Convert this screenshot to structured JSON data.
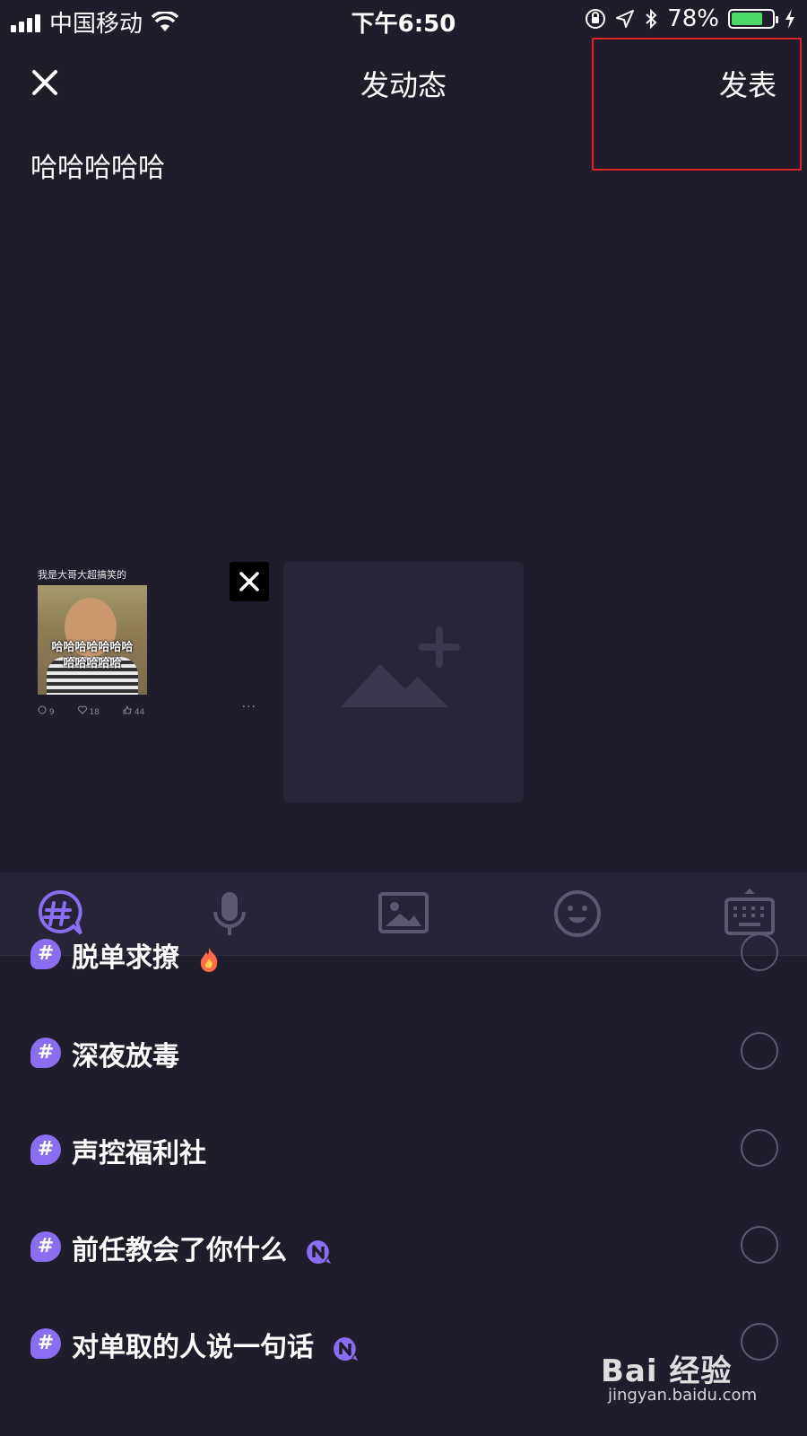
{
  "status_bar": {
    "carrier": "中国移动",
    "time": "下午6:50",
    "battery": "78%",
    "battery_level": 0.78,
    "icons": [
      "signal-icon",
      "wifi-icon",
      "orientation-lock-icon",
      "location-icon",
      "bluetooth-icon",
      "battery-icon",
      "charging-icon"
    ]
  },
  "nav": {
    "title": "发动态",
    "publish_label": "发表",
    "close_icon": "close-icon"
  },
  "post": {
    "text": "哈哈哈哈哈"
  },
  "attachment": {
    "caption": "我是大哥大超搞笑的",
    "image_text_line1": "哈哈哈哈哈哈哈",
    "image_text_line2": "哈哈哈哈哈",
    "stats": {
      "comments": "9",
      "favorites": "18",
      "likes": "44"
    },
    "more": "···"
  },
  "toolbar": {
    "tools": [
      "topic-icon",
      "microphone-icon",
      "image-icon",
      "emoji-icon",
      "keyboard-icon"
    ]
  },
  "topics": [
    {
      "label": "脱单求撩",
      "badge": "hot"
    },
    {
      "label": "深夜放毒",
      "badge": ""
    },
    {
      "label": "声控福利社",
      "badge": ""
    },
    {
      "label": "前任教会了你什么",
      "badge": "new"
    },
    {
      "label": "对单取的人说一句话",
      "badge": "new"
    }
  ],
  "watermark": {
    "brand": "Bai 经验",
    "url": "jingyan.baidu.com"
  },
  "colors": {
    "background": "#1f1d2c",
    "accent": "#8a6df0",
    "highlight": "#e1242a",
    "battery": "#4cd964"
  }
}
